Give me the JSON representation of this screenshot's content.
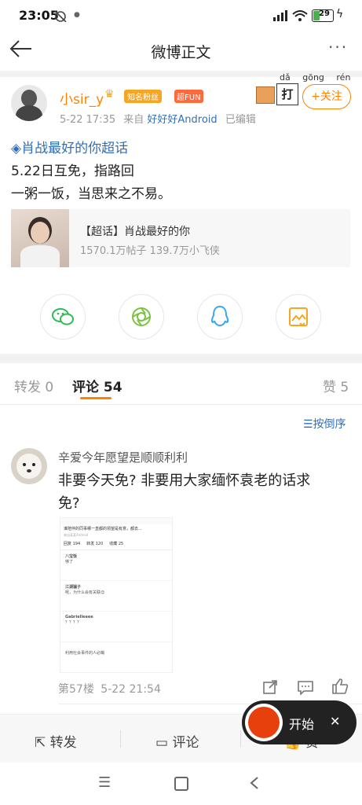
{
  "status_bar": {
    "time": "23:05",
    "battery": "29"
  },
  "header": {
    "title": "微博正文"
  },
  "post": {
    "username": "小sir_y",
    "badge_fan": "知名粉丝",
    "badge_fun": "超FUN",
    "meta_date": "5-22 17:35",
    "meta_from_prefix": "来自",
    "meta_source": "好好好Android",
    "meta_edited": "已编辑",
    "pinyin": [
      "dǎ",
      "gōng",
      "rén"
    ],
    "sticker_char": "打",
    "follow_label": "+关注",
    "topic": "肖战最好的你超话",
    "text_line1": "5.22日互免，指路回",
    "text_line2": "一粥一饭，当思来之不易。",
    "card": {
      "title": "【超话】肖战最好的你",
      "stats": "1570.1万帖子 139.7万小飞侠"
    }
  },
  "share_icons": [
    "wechat-icon",
    "moments-icon",
    "qq-icon",
    "save-image-icon"
  ],
  "tabs": {
    "repost": "转发 0",
    "comment": "评论 54",
    "like": "赞 5"
  },
  "sort_label": "按倒序",
  "comment": {
    "username": "辛爱今年愿望是顺顺利利",
    "text_line1": "非要今天免? 非要用大家缅怀袁老的话求",
    "text_line2": "免?",
    "floor": "第57楼",
    "time": "5-22 21:54",
    "screenshot": {
      "headline": "谁陪伴的同事哪一直都的领望是有意，都去...",
      "subline": "来自某某Android",
      "tabs": [
        "回复 194",
        "转发 120",
        "收藏 25"
      ],
      "rows": [
        {
          "name": "八宝饭",
          "text": "够了"
        },
        {
          "name": "江湖骗子",
          "text": "呢，为什么会有关联😊"
        },
        {
          "name": "Gabrielleeee",
          "text": "？？？？"
        },
        {
          "name": "",
          "text": "利用社会事件的人必糊"
        }
      ]
    }
  },
  "floating": {
    "start_label": "开始",
    "close": "✕"
  },
  "bottom_actions": {
    "repost": "转发",
    "comment": "评论",
    "like": "赞"
  },
  "colors": {
    "accent": "#ff8200",
    "link": "#2f6fba"
  }
}
